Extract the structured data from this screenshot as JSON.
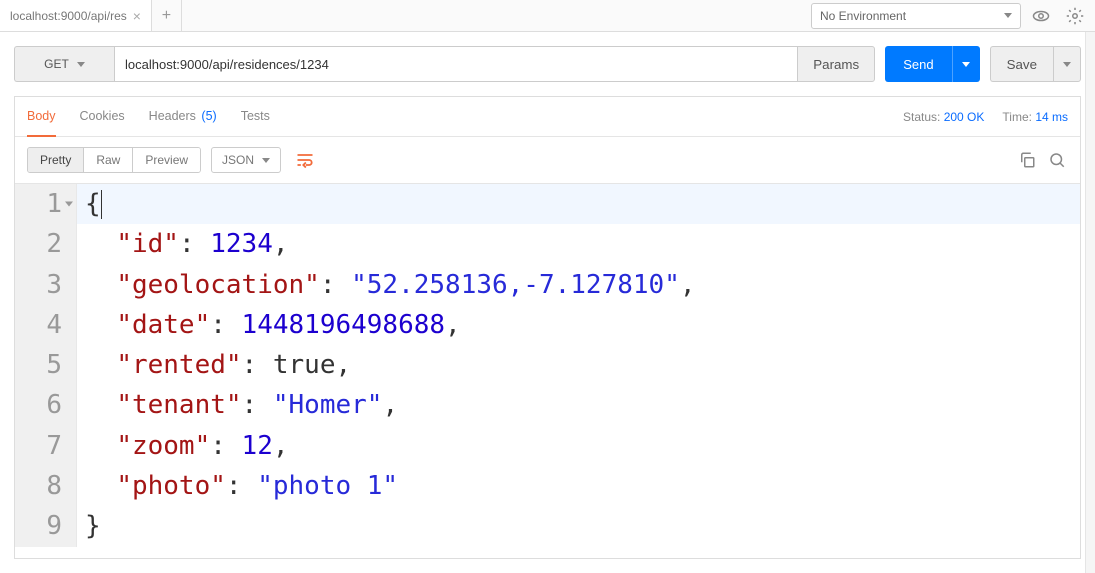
{
  "topbar": {
    "tab_title": "localhost:9000/api/res",
    "env_label": "No Environment"
  },
  "request": {
    "method": "GET",
    "url": "localhost:9000/api/residences/1234",
    "params_label": "Params",
    "send_label": "Send",
    "save_label": "Save"
  },
  "response": {
    "tabs": {
      "body": "Body",
      "cookies": "Cookies",
      "headers": "Headers",
      "headers_count": "(5)",
      "tests": "Tests"
    },
    "status_label": "Status:",
    "status_value": "200 OK",
    "time_label": "Time:",
    "time_value": "14 ms",
    "view_modes": {
      "pretty": "Pretty",
      "raw": "Raw",
      "preview": "Preview"
    },
    "format_label": "JSON"
  },
  "code_lines": [
    {
      "n": 1,
      "fold": true,
      "tokens": [
        [
          "punc",
          "{"
        ]
      ]
    },
    {
      "n": 2,
      "tokens": [
        [
          "indent",
          "  "
        ],
        [
          "key",
          "\"id\""
        ],
        [
          "punc",
          ": "
        ],
        [
          "num",
          "1234"
        ],
        [
          "punc",
          ","
        ]
      ]
    },
    {
      "n": 3,
      "tokens": [
        [
          "indent",
          "  "
        ],
        [
          "key",
          "\"geolocation\""
        ],
        [
          "punc",
          ": "
        ],
        [
          "str",
          "\"52.258136,-7.127810\""
        ],
        [
          "punc",
          ","
        ]
      ]
    },
    {
      "n": 4,
      "tokens": [
        [
          "indent",
          "  "
        ],
        [
          "key",
          "\"date\""
        ],
        [
          "punc",
          ": "
        ],
        [
          "num",
          "1448196498688"
        ],
        [
          "punc",
          ","
        ]
      ]
    },
    {
      "n": 5,
      "tokens": [
        [
          "indent",
          "  "
        ],
        [
          "key",
          "\"rented\""
        ],
        [
          "punc",
          ": "
        ],
        [
          "bool",
          "true"
        ],
        [
          "punc",
          ","
        ]
      ]
    },
    {
      "n": 6,
      "tokens": [
        [
          "indent",
          "  "
        ],
        [
          "key",
          "\"tenant\""
        ],
        [
          "punc",
          ": "
        ],
        [
          "str",
          "\"Homer\""
        ],
        [
          "punc",
          ","
        ]
      ]
    },
    {
      "n": 7,
      "tokens": [
        [
          "indent",
          "  "
        ],
        [
          "key",
          "\"zoom\""
        ],
        [
          "punc",
          ": "
        ],
        [
          "num",
          "12"
        ],
        [
          "punc",
          ","
        ]
      ]
    },
    {
      "n": 8,
      "tokens": [
        [
          "indent",
          "  "
        ],
        [
          "key",
          "\"photo\""
        ],
        [
          "punc",
          ": "
        ],
        [
          "str",
          "\"photo 1\""
        ]
      ]
    },
    {
      "n": 9,
      "tokens": [
        [
          "punc",
          "}"
        ]
      ]
    }
  ]
}
